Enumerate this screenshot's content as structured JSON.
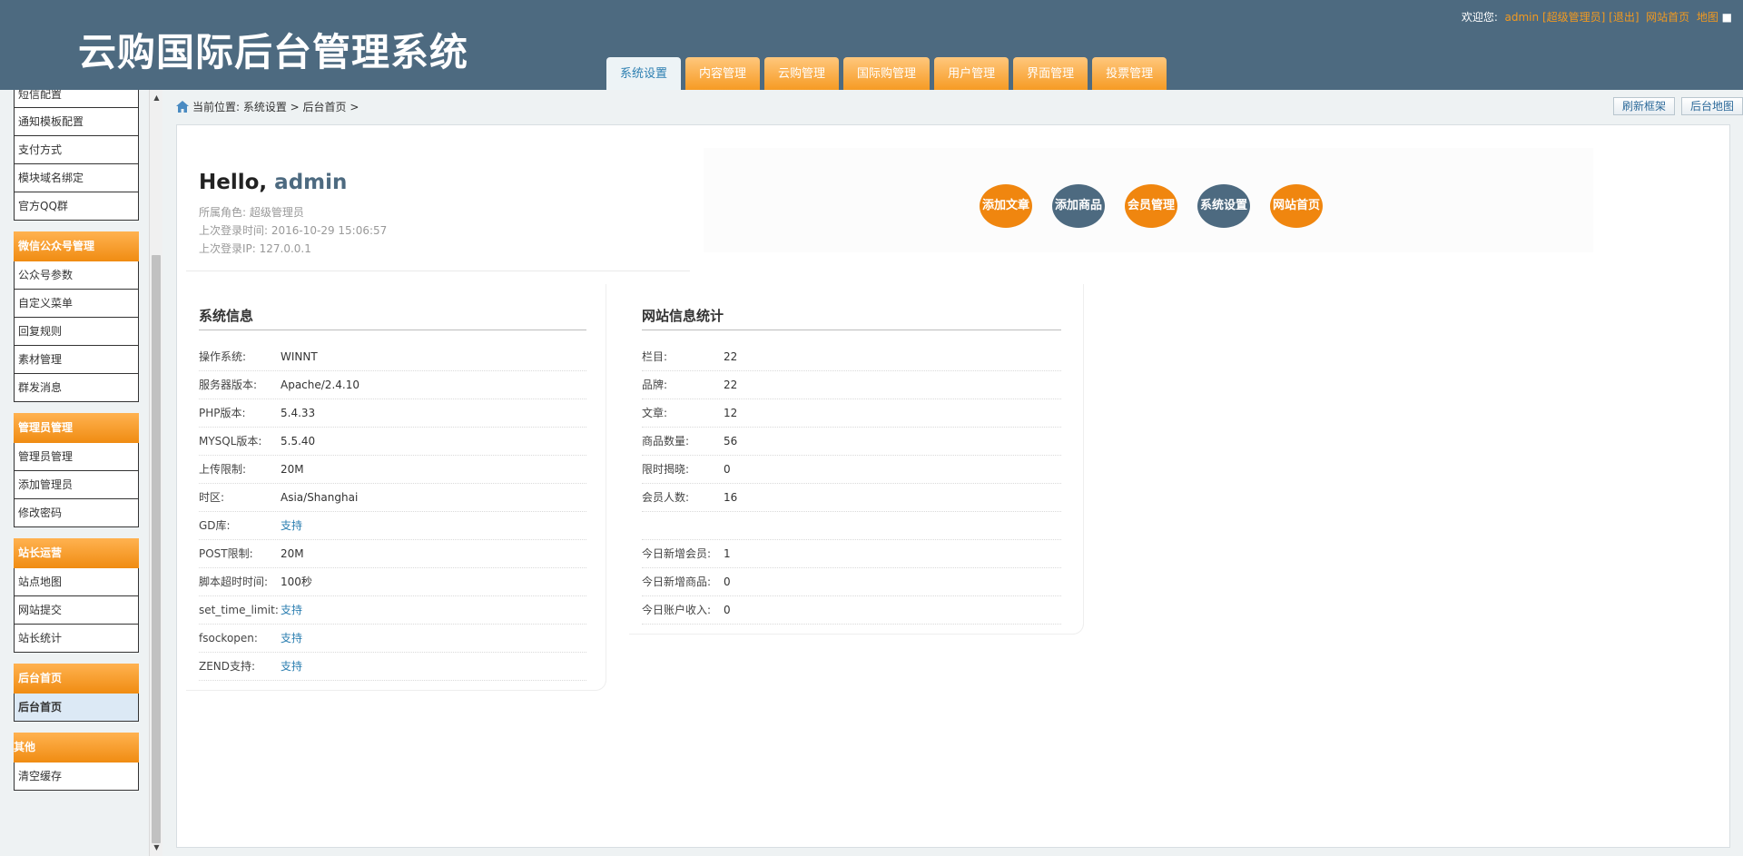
{
  "header": {
    "logo": "云购国际后台管理系统",
    "welcome": "欢迎您:",
    "user": "admin",
    "role": "[超级管理员]",
    "logout": "[退出]",
    "home_link": "网站首页",
    "map_link": "地图",
    "tabs": [
      {
        "label": "系统设置",
        "active": true
      },
      {
        "label": "内容管理"
      },
      {
        "label": "云购管理"
      },
      {
        "label": "国际购管理"
      },
      {
        "label": "用户管理"
      },
      {
        "label": "界面管理"
      },
      {
        "label": "投票管理"
      }
    ]
  },
  "sidebar": {
    "top_items": [
      "短信配置",
      "通知模板配置",
      "支付方式",
      "模块域名绑定",
      "官方QQ群"
    ],
    "groups": [
      {
        "title": "微信公众号管理",
        "items": [
          "公众号参数",
          "自定义菜单",
          "回复规则",
          "素材管理",
          "群发消息"
        ]
      },
      {
        "title": "管理员管理",
        "items": [
          "管理员管理",
          "添加管理员",
          "修改密码"
        ]
      },
      {
        "title": "站长运营",
        "items": [
          "站点地图",
          "网站提交",
          "站长统计"
        ]
      },
      {
        "title": "后台首页",
        "items": [
          "后台首页"
        ]
      },
      {
        "title": "其他",
        "items": [
          "清空缓存"
        ]
      }
    ]
  },
  "breadcrumb": {
    "text": "当前位置: 系统设置 > 后台首页 >",
    "refresh": "刷新框架",
    "admin_map": "后台地图"
  },
  "hello": {
    "greeting": "Hello,",
    "user": "admin",
    "role": "所属角色: 超级管理员",
    "last_time": "上次登录时间: 2016-10-29 15:06:57",
    "last_ip": "上次登录IP: 127.0.0.1"
  },
  "quick": [
    "添加文章",
    "添加商品",
    "会员管理",
    "系统设置",
    "网站首页"
  ],
  "colors": {
    "header": "#4d6a80",
    "accent": "#f0860f",
    "link": "#2d7fb1"
  },
  "sysinfo": {
    "title": "系统信息",
    "rows": [
      {
        "k": "操作系统:",
        "v": "WINNT"
      },
      {
        "k": "服务器版本:",
        "v": "Apache/2.4.10"
      },
      {
        "k": "PHP版本:",
        "v": "5.4.33"
      },
      {
        "k": "MYSQL版本:",
        "v": "5.5.40"
      },
      {
        "k": "上传限制:",
        "v": "20M"
      },
      {
        "k": "时区:",
        "v": "Asia/Shanghai"
      },
      {
        "k": "GD库:",
        "v": "支持"
      },
      {
        "k": "POST限制:",
        "v": "20M"
      },
      {
        "k": "脚本超时时间:",
        "v": "100秒"
      },
      {
        "k": "set_time_limit:",
        "v": "支持"
      },
      {
        "k": "fsockopen:",
        "v": "支持"
      },
      {
        "k": "ZEND支持:",
        "v": "支持"
      }
    ]
  },
  "stats": {
    "title": "网站信息统计",
    "rows": [
      {
        "k": "栏目:",
        "v": "22"
      },
      {
        "k": "品牌:",
        "v": "22"
      },
      {
        "k": "文章:",
        "v": "12"
      },
      {
        "k": "商品数量:",
        "v": "56"
      },
      {
        "k": "限时揭晓:",
        "v": "0"
      },
      {
        "k": "会员人数:",
        "v": "16"
      }
    ],
    "today": [
      {
        "k": "今日新增会员:",
        "v": "1"
      },
      {
        "k": "今日新增商品:",
        "v": "0"
      },
      {
        "k": "今日账户收入:",
        "v": "0"
      }
    ]
  }
}
